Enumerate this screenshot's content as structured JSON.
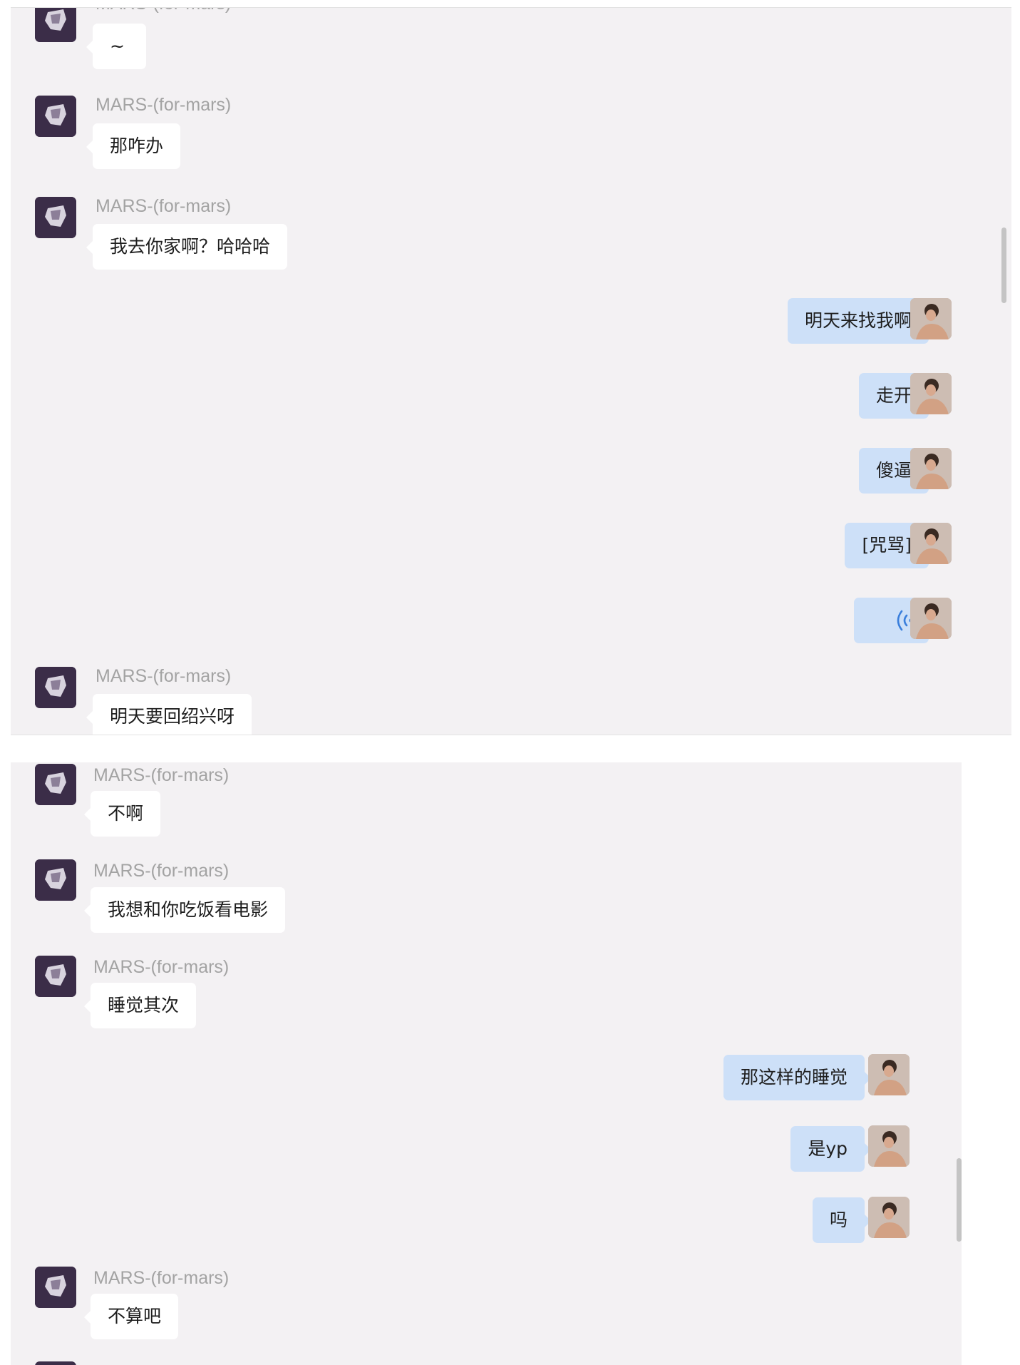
{
  "chat_top": {
    "sender_name": "MARS-(for-mars)",
    "messages": [
      {
        "from": "other",
        "name": "MARS-(for-mars)",
        "text": "~"
      },
      {
        "from": "other",
        "name": "MARS-(for-mars)",
        "text": "那咋办"
      },
      {
        "from": "other",
        "name": "MARS-(for-mars)",
        "text": "我去你家啊？哈哈哈"
      },
      {
        "from": "me",
        "text": "明天来找我啊"
      },
      {
        "from": "me",
        "text": "走开"
      },
      {
        "from": "me",
        "text": "傻逼"
      },
      {
        "from": "me",
        "text": "[咒骂]"
      },
      {
        "from": "me",
        "type": "voice",
        "icon": "voice-message-icon"
      },
      {
        "from": "other",
        "name": "MARS-(for-mars)",
        "text": "明天要回绍兴呀"
      }
    ]
  },
  "chat_bottom": {
    "messages": [
      {
        "from": "other",
        "name": "MARS-(for-mars)",
        "text": "不啊"
      },
      {
        "from": "other",
        "name": "MARS-(for-mars)",
        "text": "我想和你吃饭看电影"
      },
      {
        "from": "other",
        "name": "MARS-(for-mars)",
        "text": "睡觉其次"
      },
      {
        "from": "me",
        "text": "那这样的睡觉"
      },
      {
        "from": "me",
        "text": "是yp"
      },
      {
        "from": "me",
        "text": "吗"
      },
      {
        "from": "other",
        "name": "MARS-(for-mars)",
        "text": "不算吧"
      }
    ]
  },
  "colors": {
    "panel_background": "#f3f1f3",
    "other_bubble": "#ffffff",
    "my_bubble": "#cde0f8",
    "sender_name": "#a3a3a3",
    "voice_icon": "#3a7fdc"
  }
}
